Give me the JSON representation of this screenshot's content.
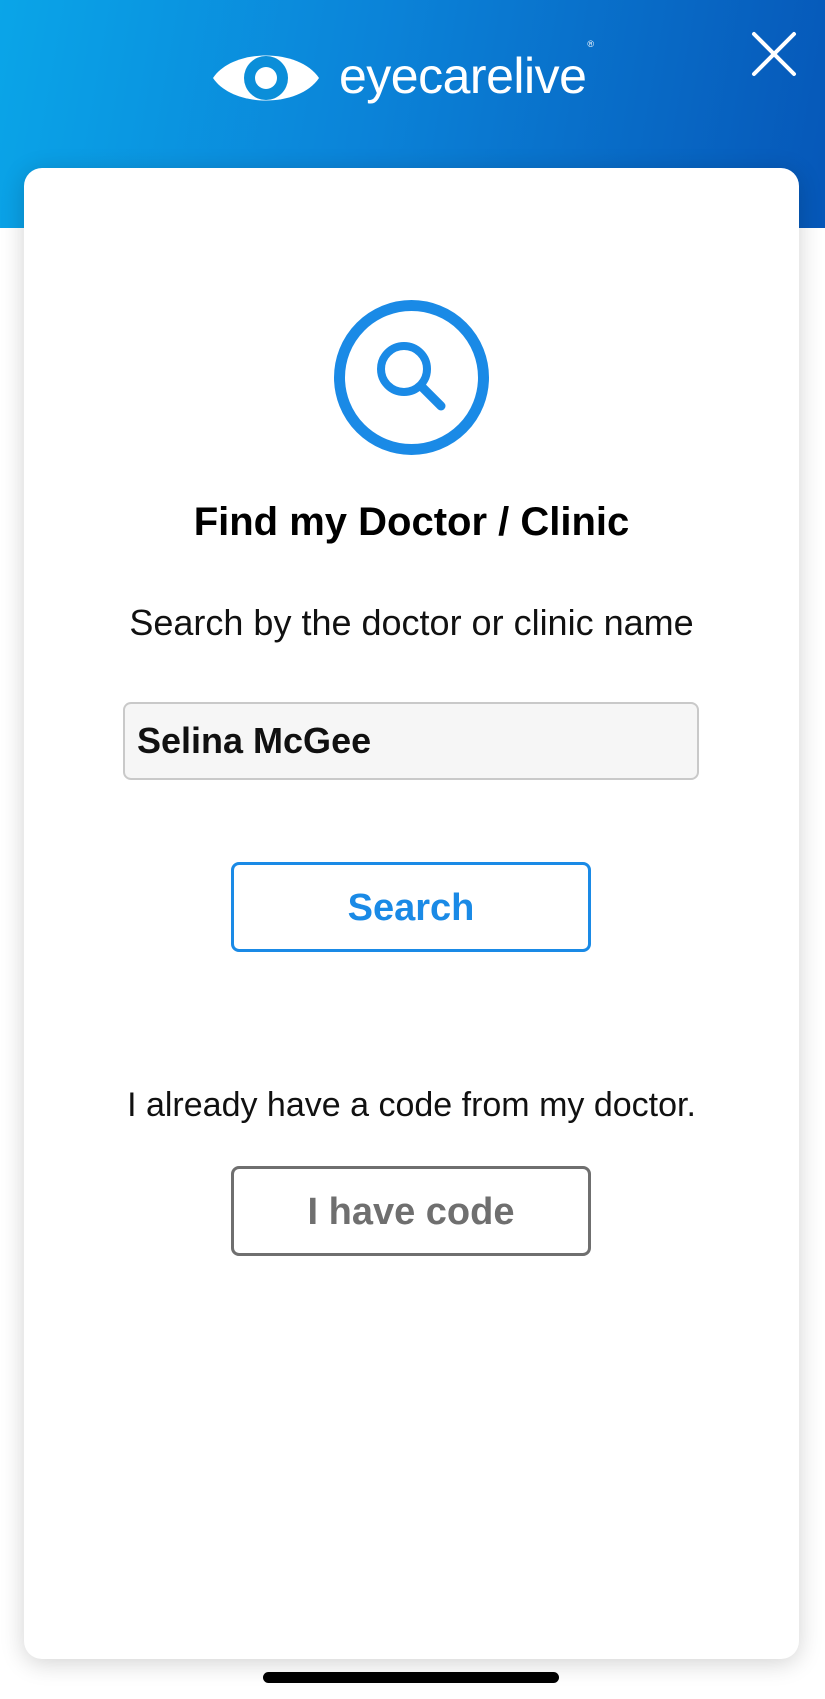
{
  "header": {
    "brand_name": "eyecarelive",
    "brand_mark": "®",
    "logo_icon": "eye-icon",
    "close_icon": "close-icon",
    "gradient": [
      "#0aa5e8",
      "#0657b8"
    ]
  },
  "card": {
    "hero_icon": "search-icon",
    "title": "Find my Doctor / Clinic",
    "subtitle": "Search by the doctor or clinic name",
    "search_input": {
      "value": "Selina McGee",
      "placeholder": ""
    },
    "search_button_label": "Search",
    "code_prompt": "I already have a code from my doctor.",
    "code_button_label": "I have code"
  },
  "colors": {
    "accent": "#1a8ae6",
    "secondary_button": "#6f6f6f"
  }
}
